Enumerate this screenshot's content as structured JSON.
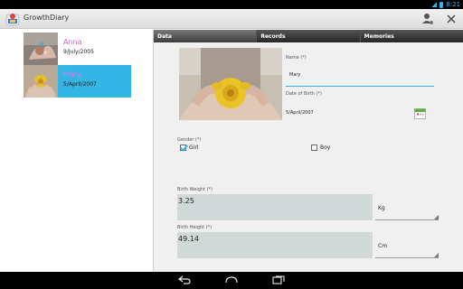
{
  "status_bar": {
    "time": "8:21"
  },
  "app": {
    "title": "GrowthDiary"
  },
  "children": [
    {
      "name": "Anna",
      "dob": "9/July/2005"
    },
    {
      "name": "Mary",
      "dob": "5/April/2007"
    }
  ],
  "tabs": [
    {
      "label": "Data"
    },
    {
      "label": "Records"
    },
    {
      "label": "Memories"
    }
  ],
  "form": {
    "name_label": "Name (*)",
    "name_value": "Mary",
    "dob_label": "Date of Birth (*)",
    "dob_value": "5/April/2007",
    "gender_label": "Gender (*)",
    "girl_label": "Girl",
    "boy_label": "Boy",
    "gender_selected": "Girl",
    "birth_weight_label": "Birth Weight (*)",
    "birth_weight_value": "3.25",
    "weight_unit": "Kg",
    "birth_height_label": "Birth Height (*)",
    "birth_height_value": "49.14",
    "height_unit": "Cm"
  },
  "colors": {
    "accent": "#33b5e5",
    "name_pink": "#d35bd0",
    "field_bg": "#d0d8d8"
  },
  "icons": {
    "app": "app-logo-icon",
    "user_settings": "user-settings-icon",
    "close": "close-icon",
    "calendar": "calendar-icon",
    "back": "back-icon",
    "home": "home-icon",
    "recents": "recents-icon"
  }
}
